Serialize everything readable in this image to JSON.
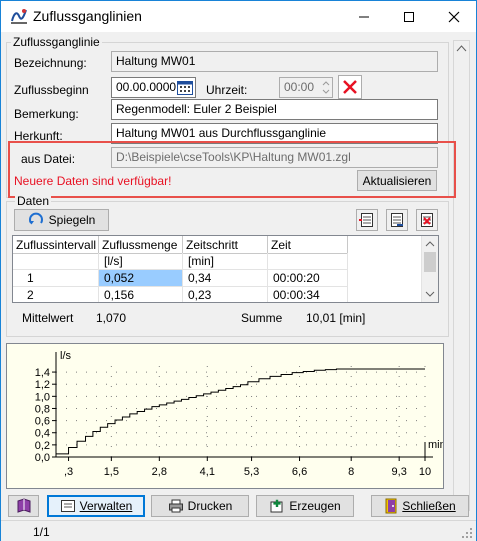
{
  "window": {
    "title": "Zuflussganglinien"
  },
  "group_main": {
    "label": "Zuflussganglinie",
    "bezeichnung_label": "Bezeichnung:",
    "bezeichnung_value": "Haltung MW01",
    "zuflussbeginn_label": "Zuflussbeginn",
    "zuflussbeginn_value": "00.00.0000",
    "uhrzeit_label": "Uhrzeit:",
    "uhrzeit_value": "00:00",
    "bemerkung_label": "Bemerkung:",
    "bemerkung_value": "Regenmodell: Euler 2 Beispiel",
    "herkunft_label": "Herkunft:",
    "herkunft_value": "Haltung MW01 aus Durchflussganglinie",
    "ausdatei_label": "aus Datei:",
    "ausdatei_value": "D:\\Beispiele\\cseTools\\KP\\Haltung MW01.zgl",
    "warning": "Neuere Daten sind verfügbar!",
    "aktualisieren_label": "Aktualisieren",
    "highlight_color": "#e81123"
  },
  "group_daten": {
    "label": "Daten",
    "spiegeln_label": "Spiegeln",
    "columns": [
      "Zuflussintervall",
      "Zuflussmenge",
      "Zeitschritt",
      "Zeit"
    ],
    "units": [
      "",
      "[l/s]",
      "[min]",
      ""
    ],
    "rows": [
      [
        "1",
        "0,052",
        "0,34",
        "00:00:20"
      ],
      [
        "2",
        "0,156",
        "0,23",
        "00:00:34"
      ]
    ],
    "mittelwert_label": "Mittelwert",
    "mittelwert_value": "1,070",
    "summe_label": "Summe",
    "summe_value": "10,01 [min]"
  },
  "chart_data": {
    "type": "line",
    "ylabel": "l/s",
    "xlabel": "min",
    "y_ticks": [
      "1,4",
      "1,2",
      "1,0",
      "0,8",
      "0,6",
      "0,4",
      "0,2",
      "0,0"
    ],
    "x_ticks": [
      ",3",
      "1,5",
      "2,8",
      "4,1",
      "5,3",
      "6,6",
      "8",
      "9,3",
      "10"
    ],
    "ylim": [
      0,
      1.5
    ],
    "xlim": [
      0,
      10
    ],
    "grid": "dotted",
    "background_color": "#ffffee",
    "line_color": "#000000",
    "x": [
      0.34,
      0.57,
      0.8,
      1.0,
      1.2,
      1.4,
      1.6,
      1.8,
      2.0,
      2.2,
      2.4,
      2.6,
      2.8,
      3.0,
      3.2,
      3.4,
      3.6,
      3.8,
      4.0,
      4.2,
      4.4,
      4.6,
      4.8,
      5.0,
      5.2,
      5.5,
      5.8,
      6.1,
      6.4,
      6.7,
      7.0,
      7.3,
      7.6,
      8.0,
      10.0
    ],
    "values": [
      0.052,
      0.156,
      0.26,
      0.34,
      0.42,
      0.49,
      0.55,
      0.61,
      0.66,
      0.71,
      0.75,
      0.79,
      0.83,
      0.86,
      0.89,
      0.92,
      0.95,
      0.98,
      1.01,
      1.04,
      1.07,
      1.1,
      1.13,
      1.16,
      1.19,
      1.24,
      1.29,
      1.33,
      1.36,
      1.39,
      1.41,
      1.43,
      1.44,
      1.45,
      1.45
    ]
  },
  "footer": {
    "verwalten_label": "Verwalten",
    "drucken_label": "Drucken",
    "erzeugen_label": "Erzeugen",
    "schliessen_label": "Schließen"
  },
  "statusbar": {
    "page": "1/1"
  }
}
